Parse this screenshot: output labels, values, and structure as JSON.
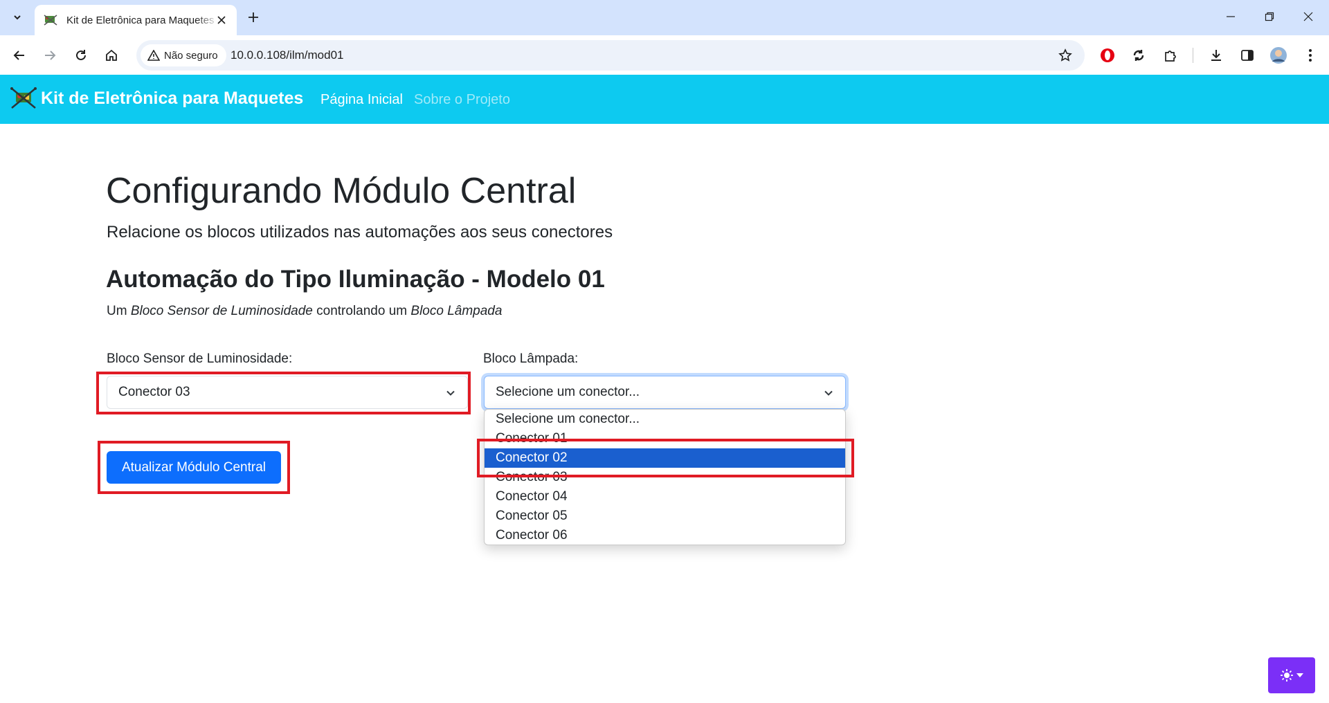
{
  "browser": {
    "tab_title": "Kit de Eletrônica para Maquetes",
    "security_label": "Não seguro",
    "url": "10.0.0.108/ilm/mod01"
  },
  "navbar": {
    "brand": "Kit de Eletrônica para Maquetes",
    "links": [
      {
        "label": "Página Inicial",
        "active": true
      },
      {
        "label": "Sobre o Projeto",
        "active": false
      }
    ]
  },
  "page": {
    "title": "Configurando Módulo Central",
    "lead": "Relacione os blocos utilizados nas automações aos seus conectores",
    "section_title": "Automação do Tipo Iluminação - Modelo 01",
    "desc_prefix": "Um",
    "desc_block1": "Bloco Sensor de Luminosidade",
    "desc_middle": "controlando um",
    "desc_block2": "Bloco Lâmpada"
  },
  "form": {
    "sensor_label": "Bloco Sensor de Luminosidade:",
    "sensor_value": "Conector 03",
    "lamp_label": "Bloco Lâmpada:",
    "lamp_value": "Selecione um conector...",
    "lamp_options": [
      "Selecione um conector...",
      "Conector 01",
      "Conector 02",
      "Conector 03",
      "Conector 04",
      "Conector 05",
      "Conector 06"
    ],
    "lamp_highlighted_option": "Conector 02",
    "submit_label": "Atualizar Módulo Central"
  },
  "colors": {
    "navbar": "#0dcaf0",
    "primary": "#0d6efd",
    "highlight": "#e01b24",
    "option_selected": "#1a5fcf",
    "theme_button": "#7b2ff7"
  }
}
